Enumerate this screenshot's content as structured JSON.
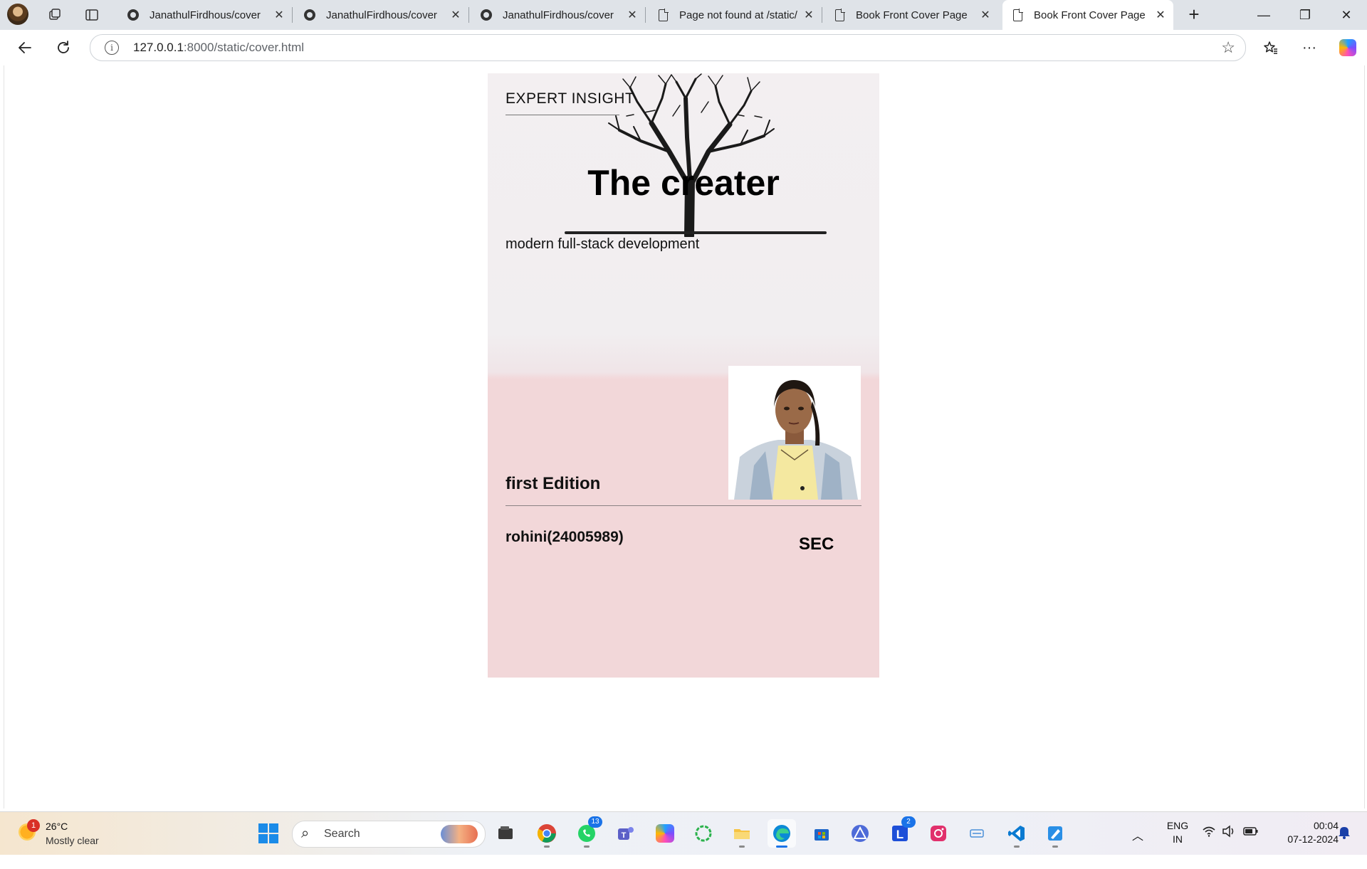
{
  "browser": {
    "tabs": [
      {
        "title": "JanathulFirdhous/cover",
        "icon": "github-icon"
      },
      {
        "title": "JanathulFirdhous/cover",
        "icon": "github-icon"
      },
      {
        "title": "JanathulFirdhous/cover",
        "icon": "github-icon"
      },
      {
        "title": "Page not found at /static/",
        "icon": "page-icon"
      },
      {
        "title": "Book Front Cover Page",
        "icon": "page-icon"
      },
      {
        "title": "Book Front Cover Page",
        "icon": "page-icon",
        "active": true
      }
    ],
    "address": {
      "host": "127.0.0.1",
      "rest": ":8000/static/cover.html"
    }
  },
  "cover": {
    "series_label": "EXPERT INSIGHT",
    "title": "The creater",
    "subtitle": "modern full-stack development",
    "edition": "first Edition",
    "author": "rohini(24005989)",
    "publisher": "SEC",
    "colors": {
      "top": "#f2eef0",
      "bottom": "#f2d7d9"
    }
  },
  "taskbar": {
    "weather": {
      "badge": "1",
      "temp": "26°C",
      "condition": "Mostly clear"
    },
    "search_placeholder": "Search",
    "apps": [
      {
        "name": "file-explorer-icon"
      },
      {
        "name": "chrome-icon"
      },
      {
        "name": "whatsapp-icon",
        "badge": "13"
      },
      {
        "name": "teams-icon"
      },
      {
        "name": "copilot-icon"
      },
      {
        "name": "loading-ring-icon"
      },
      {
        "name": "folder-icon"
      },
      {
        "name": "edge-icon",
        "current": true
      },
      {
        "name": "store-icon"
      },
      {
        "name": "triangle-app-icon"
      },
      {
        "name": "l-app-icon",
        "badge": "2"
      },
      {
        "name": "instagram-icon"
      },
      {
        "name": "cpu-app-icon"
      },
      {
        "name": "vscode-icon"
      },
      {
        "name": "paint-icon"
      }
    ],
    "tray": {
      "lang_top": "ENG",
      "lang_bottom": "IN",
      "time": "00:04",
      "date": "07-12-2024"
    }
  }
}
